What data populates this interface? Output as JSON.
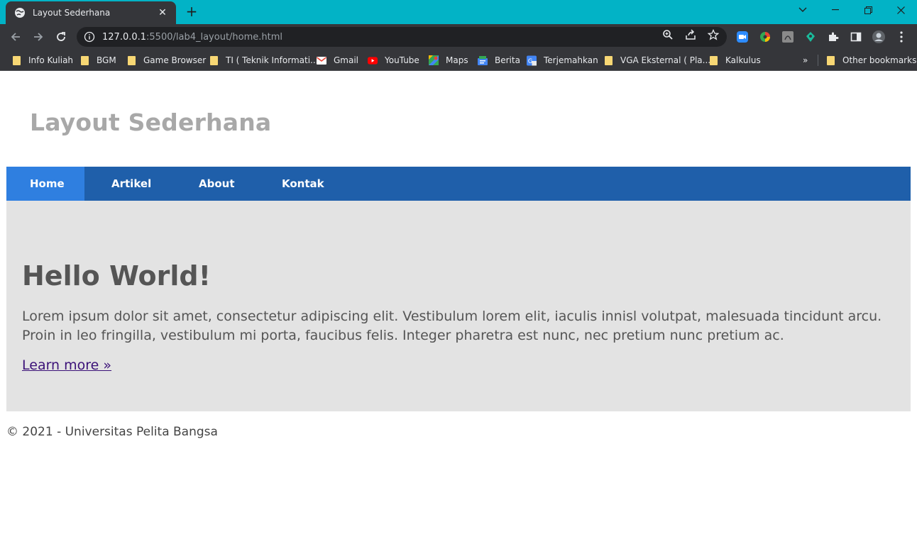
{
  "browser": {
    "tab_title": "Layout Sederhana",
    "url_host": "127.0.0.1",
    "url_path": ":5500/lab4_layout/home.html",
    "bookmarks": [
      {
        "label": "Info Kuliah",
        "icon": "folder-icon"
      },
      {
        "label": "BGM",
        "icon": "folder-icon"
      },
      {
        "label": "Game Browser",
        "icon": "folder-icon"
      },
      {
        "label": "TI ( Teknik Informati...",
        "icon": "folder-icon"
      },
      {
        "label": "Gmail",
        "icon": "gmail-icon"
      },
      {
        "label": "YouTube",
        "icon": "youtube-icon"
      },
      {
        "label": "Maps",
        "icon": "maps-icon"
      },
      {
        "label": "Berita",
        "icon": "news-icon"
      },
      {
        "label": "Terjemahkan",
        "icon": "translate-icon"
      },
      {
        "label": "VGA Eksternal ( Pla...",
        "icon": "folder-icon"
      },
      {
        "label": "Kalkulus",
        "icon": "folder-icon"
      }
    ],
    "overflow_label": "»",
    "other_bookmarks": "Other bookmarks",
    "colors": {
      "titlebar": "#02b3c6",
      "toolbar": "#35363a"
    }
  },
  "site": {
    "title": "Layout Sederhana",
    "nav": [
      "Home",
      "Artikel",
      "About",
      "Kontak"
    ],
    "active_nav": "Home",
    "hero": {
      "heading": "Hello World!",
      "text": "Lorem ipsum dolor sit amet, consectetur adipiscing elit. Vestibulum lorem elit, iaculis innisl volutpat, malesuada tincidunt arcu. Proin in leo fringilla, vestibulum mi porta, faucibus felis. Integer pharetra est nunc, nec pretium nunc pretium ac.",
      "link": "Learn more »"
    },
    "footer": "© 2021 - Universitas Pelita Bangsa",
    "colors": {
      "nav": "#1f5faa",
      "nav_active": "#2f7fe0",
      "hero_bg": "#e3e3e3"
    }
  }
}
